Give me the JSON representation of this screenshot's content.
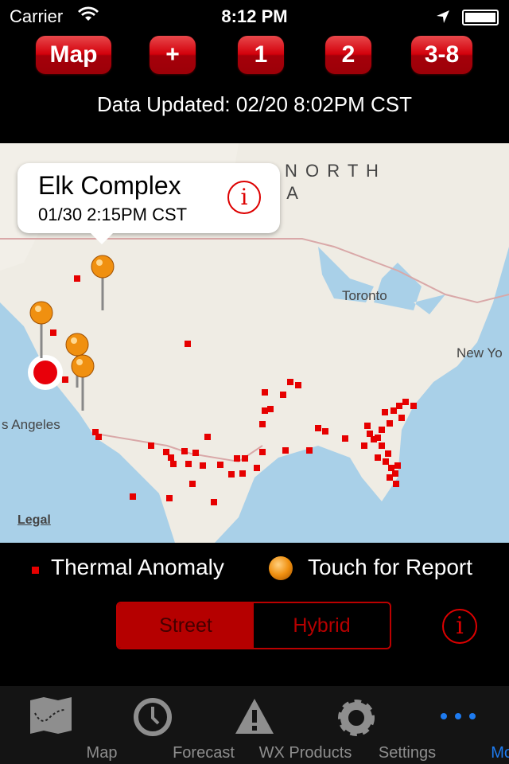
{
  "status": {
    "carrier": "Carrier",
    "time": "8:12 PM"
  },
  "toolbar": {
    "buttons": [
      "Map",
      "+",
      "1",
      "2",
      "3-8"
    ]
  },
  "updated": "Data Updated:  02/20 8:02PM CST",
  "map": {
    "labels": {
      "north": "N O R T H",
      "america": "M E R I C A",
      "toronto": "Toronto",
      "new_york": "New Yo",
      "los_angeles": "s Angeles",
      "legal": "Legal"
    },
    "callout": {
      "title": "Elk Complex",
      "subtitle": "01/30 2:15PM CST"
    },
    "colors": {
      "anomaly": "#e60000",
      "pin": "#f09010"
    }
  },
  "legend": {
    "anomaly": "Thermal Anomaly",
    "report": "Touch for Report"
  },
  "map_type": {
    "options": [
      "Street",
      "Hybrid"
    ],
    "selected": "Street"
  },
  "tabs": [
    {
      "label": "Map",
      "icon": "map-icon"
    },
    {
      "label": "Forecast",
      "icon": "clock-icon"
    },
    {
      "label": "WX Products",
      "icon": "warning-icon"
    },
    {
      "label": "Settings",
      "icon": "gear-icon"
    },
    {
      "label": "More",
      "icon": "more-icon",
      "active": true
    }
  ]
}
